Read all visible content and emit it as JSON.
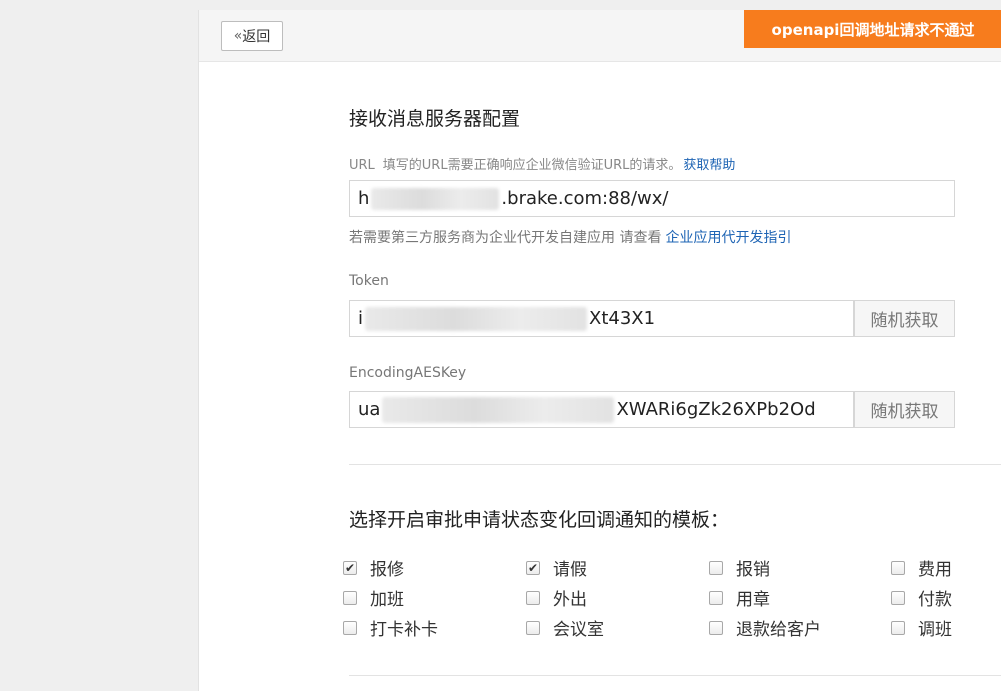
{
  "header": {
    "back_chevron": "«",
    "back_label": "返回",
    "alert_text": "openapi回调地址请求不通过"
  },
  "config": {
    "title": "接收消息服务器配置",
    "url_label": "URL",
    "url_desc": "填写的URL需要正确响应企业微信验证URL的请求。",
    "help_link": "获取帮助",
    "url_prefix": "h",
    "url_suffix": ".brake.com:88/wx/",
    "tip_text": "若需要第三方服务商为企业代开发自建应用 请查看",
    "tip_link": "企业应用代开发指引",
    "token_label": "Token",
    "token_prefix": "i",
    "token_suffix": "Xt43X1",
    "aes_label": "EncodingAESKey",
    "aes_prefix": "ua",
    "aes_suffix": "XWARi6gZk26XPb2Od",
    "random_label": "随机获取"
  },
  "templates": {
    "title": "选择开启审批申请状态变化回调通知的模板：",
    "items": [
      {
        "label": "报修",
        "checked": true
      },
      {
        "label": "请假",
        "checked": true
      },
      {
        "label": "报销",
        "checked": false
      },
      {
        "label": "费用",
        "checked": false
      },
      {
        "label": "加班",
        "checked": false
      },
      {
        "label": "外出",
        "checked": false
      },
      {
        "label": "用章",
        "checked": false
      },
      {
        "label": "付款",
        "checked": false
      },
      {
        "label": "打卡补卡",
        "checked": false
      },
      {
        "label": "会议室",
        "checked": false
      },
      {
        "label": "退款给客户",
        "checked": false
      },
      {
        "label": "调班",
        "checked": false
      }
    ],
    "check_mark": "✔"
  },
  "colors": {
    "alert": "#f77c1d",
    "link": "#1e64b4"
  }
}
